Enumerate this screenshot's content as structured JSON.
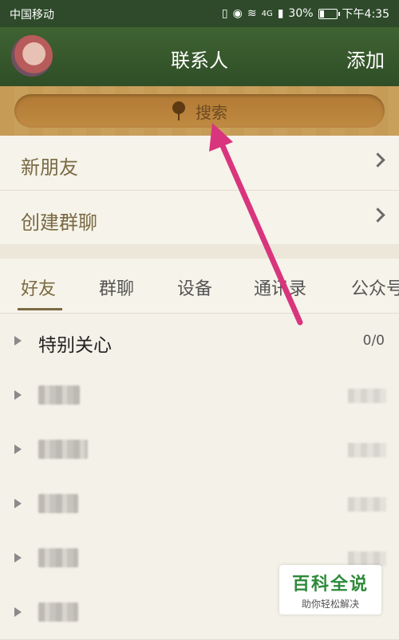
{
  "statusbar": {
    "carrier": "中国移动",
    "network": "4G",
    "battery": "30%",
    "battery_level": 0.3,
    "time": "下午4:35"
  },
  "header": {
    "title": "联系人",
    "add_label": "添加"
  },
  "search": {
    "label": "搜索"
  },
  "menu": {
    "items": [
      {
        "label": "新朋友"
      },
      {
        "label": "创建群聊"
      }
    ]
  },
  "tabs": [
    {
      "label": "好友"
    },
    {
      "label": "群聊"
    },
    {
      "label": "设备"
    },
    {
      "label": "通讯录"
    },
    {
      "label": "公众号"
    }
  ],
  "groups": [
    {
      "name": "特别关心",
      "count": "0/0"
    }
  ],
  "watermark": {
    "title": "百科全说",
    "subtitle": "助你轻松解决"
  },
  "colors": {
    "header_green": "#3f6332",
    "wood": "#c69b56",
    "accent_brown": "#7b6a42",
    "arrow_pink": "#d9357e",
    "watermark_green": "#2d8a3a"
  }
}
